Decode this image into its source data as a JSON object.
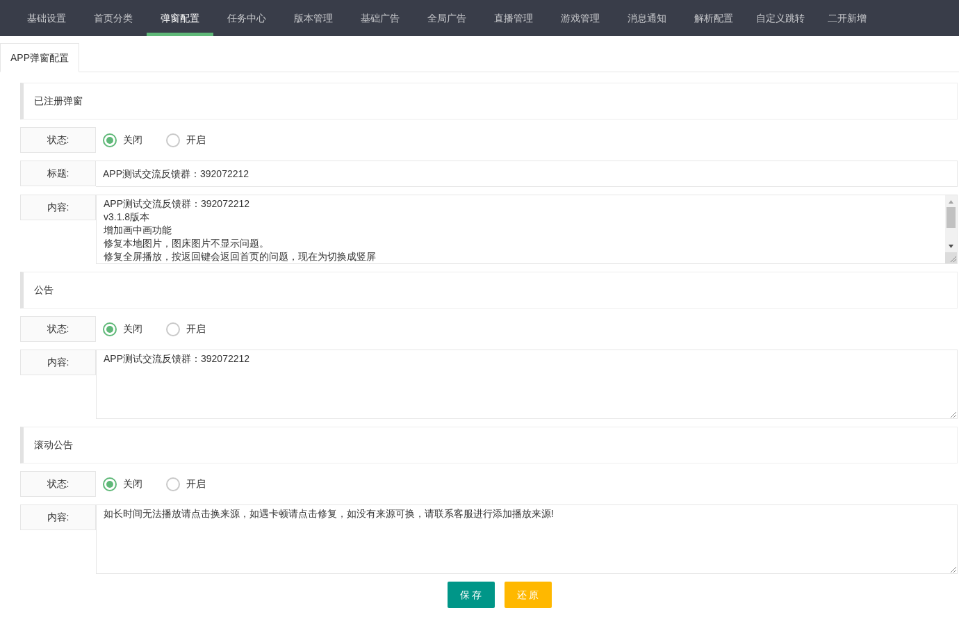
{
  "nav": [
    {
      "label": "基础设置",
      "selected": false
    },
    {
      "label": "首页分类",
      "selected": false
    },
    {
      "label": "弹窗配置",
      "selected": true
    },
    {
      "label": "任务中心",
      "selected": false
    },
    {
      "label": "版本管理",
      "selected": false
    },
    {
      "label": "基础广告",
      "selected": false
    },
    {
      "label": "全局广告",
      "selected": false
    },
    {
      "label": "直播管理",
      "selected": false
    },
    {
      "label": "游戏管理",
      "selected": false
    },
    {
      "label": "消息通知",
      "selected": false
    },
    {
      "label": "解析配置",
      "selected": false
    },
    {
      "label": "自定义跳转",
      "selected": false
    },
    {
      "label": "二开新增",
      "selected": false
    }
  ],
  "tabs": [
    {
      "label": "APP弹窗配置",
      "selected": true
    }
  ],
  "sections": [
    {
      "title": "已注册弹窗",
      "fields": [
        {
          "kind": "radio",
          "label": "状态:",
          "options": [
            {
              "label": "关闭",
              "selected": true
            },
            {
              "label": "开启",
              "selected": false
            }
          ]
        },
        {
          "kind": "text",
          "label": "标题:",
          "value": "APP测试交流反馈群：392072212"
        },
        {
          "kind": "textarea",
          "label": "内容:",
          "lines": [
            "APP测试交流反馈群：392072212",
            "v3.1.8版本",
            "增加画中画功能",
            "修复本地图片，图床图片不显示问题。",
            "修复全屏播放，按返回键会返回首页的问题，现在为切换成竖屏"
          ]
        }
      ]
    },
    {
      "title": "公告",
      "fields": [
        {
          "kind": "radio",
          "label": "状态:",
          "options": [
            {
              "label": "关闭",
              "selected": true
            },
            {
              "label": "开启",
              "selected": false
            }
          ]
        },
        {
          "kind": "textarea",
          "label": "内容:",
          "lines": [
            "APP测试交流反馈群：392072212"
          ]
        }
      ]
    },
    {
      "title": "滚动公告",
      "fields": [
        {
          "kind": "radio",
          "label": "状态:",
          "options": [
            {
              "label": "关闭",
              "selected": true
            },
            {
              "label": "开启",
              "selected": false
            }
          ]
        },
        {
          "kind": "textarea",
          "label": "内容:",
          "lines": [
            "如长时间无法播放请点击换来源，如遇卡顿请点击修复，如没有来源可换，请联系客服进行添加播放来源!"
          ]
        }
      ]
    }
  ],
  "buttons": [
    {
      "label": "保 存",
      "kind": "primary"
    },
    {
      "label": "还 原",
      "kind": "warm"
    }
  ]
}
